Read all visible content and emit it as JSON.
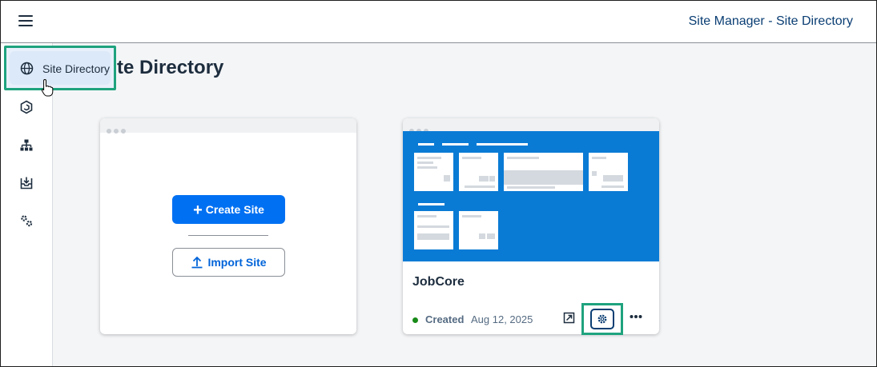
{
  "shellbar": {
    "title": "Site Manager - Site Directory"
  },
  "tooltip": {
    "label": "Site Directory"
  },
  "page": {
    "title_visible": "te Directory"
  },
  "create_card": {
    "create_label": "Create Site",
    "import_label": "Import Site"
  },
  "site_card": {
    "name": "JobCore",
    "status": "Created",
    "date": "Aug 12, 2025"
  },
  "icons": {
    "menu": "hamburger-icon",
    "globe": "globe-icon",
    "cursor": "hand-cursor-icon",
    "content": "hexagon-icon",
    "hierarchy": "sitemap-icon",
    "inbox": "download-tray-icon",
    "settings": "gears-icon",
    "plus": "plus-icon",
    "upload": "upload-icon",
    "open": "open-external-icon",
    "site_settings": "gear-icon",
    "more": "more-icon"
  },
  "colors": {
    "accent": "#0070f2",
    "highlight": "#1fa37e",
    "preview": "#0a7bd5",
    "status_positive": "#188918"
  }
}
